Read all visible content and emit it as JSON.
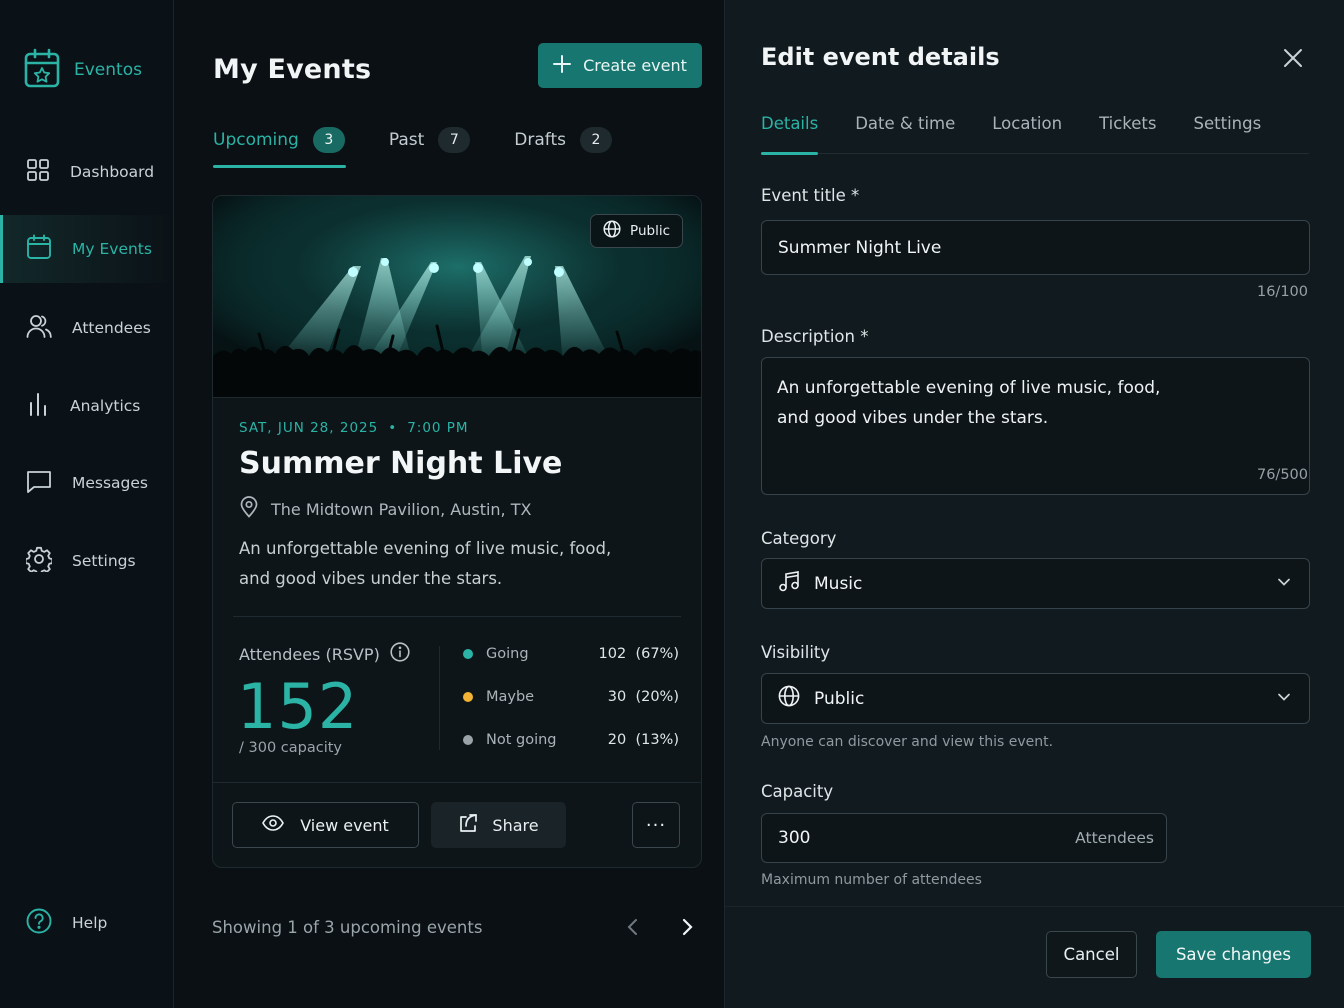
{
  "brand": {
    "name": "Eventos"
  },
  "sidebar": {
    "items": [
      {
        "label": "Dashboard",
        "icon": "grid-icon"
      },
      {
        "label": "My Events",
        "icon": "calendar-icon",
        "active": true
      },
      {
        "label": "Attendees",
        "icon": "users-icon"
      },
      {
        "label": "Analytics",
        "icon": "bar-chart-icon"
      },
      {
        "label": "Messages",
        "icon": "message-icon"
      },
      {
        "label": "Settings",
        "icon": "gear-icon"
      }
    ],
    "help_label": "Help"
  },
  "main": {
    "title": "My Events",
    "create_label": "Create event",
    "tabs": [
      {
        "label": "Upcoming",
        "count": "3",
        "active": true
      },
      {
        "label": "Past",
        "count": "7"
      },
      {
        "label": "Drafts",
        "count": "2"
      }
    ],
    "card": {
      "visibility_badge": "Public",
      "date": "SAT, JUN 28, 2025",
      "separator": "•",
      "time": "7:00 PM",
      "title": "Summer Night Live",
      "location": "The Midtown Pavilion, Austin, TX",
      "description_line1": "An unforgettable evening of live music, food,",
      "description_line2": "and good vibes under the stars.",
      "rsvp_label": "Attendees (RSVP)",
      "rsvp_total": "152",
      "capacity_text": "/ 300 capacity",
      "stats": [
        {
          "name": "Going",
          "value": "102",
          "pct": "(67%)",
          "color": "#2bb3a6"
        },
        {
          "name": "Maybe",
          "value": "30",
          "pct": "(20%)",
          "color": "#f2b233"
        },
        {
          "name": "Not going",
          "value": "20",
          "pct": "(13%)",
          "color": "#9aa3a8"
        }
      ],
      "view_label": "View event",
      "share_label": "Share",
      "more_label": "···"
    },
    "showing_text": "Showing 1 of 3 upcoming events"
  },
  "panel": {
    "title": "Edit event details",
    "tabs": [
      "Details",
      "Date & time",
      "Location",
      "Tickets",
      "Settings"
    ],
    "active_tab": "Details",
    "event_title_label": "Event title *",
    "event_title_value": "Summer Night Live",
    "event_title_counter": "16/100",
    "description_label": "Description *",
    "description_line1": "An unforgettable evening of live music, food,",
    "description_line2": "and good vibes under the stars.",
    "description_counter": "76/500",
    "category_label": "Category",
    "category_value": "Music",
    "visibility_label": "Visibility",
    "visibility_value": "Public",
    "visibility_help": "Anyone can discover and view this event.",
    "capacity_label": "Capacity",
    "capacity_value": "300",
    "capacity_suffix": "Attendees",
    "capacity_help": "Maximum number of attendees",
    "cancel_label": "Cancel",
    "save_label": "Save changes"
  },
  "colors": {
    "accent": "#2bb3a6",
    "primary_button": "#17766f",
    "background": "#0a1014",
    "panel": "#111a1f"
  }
}
